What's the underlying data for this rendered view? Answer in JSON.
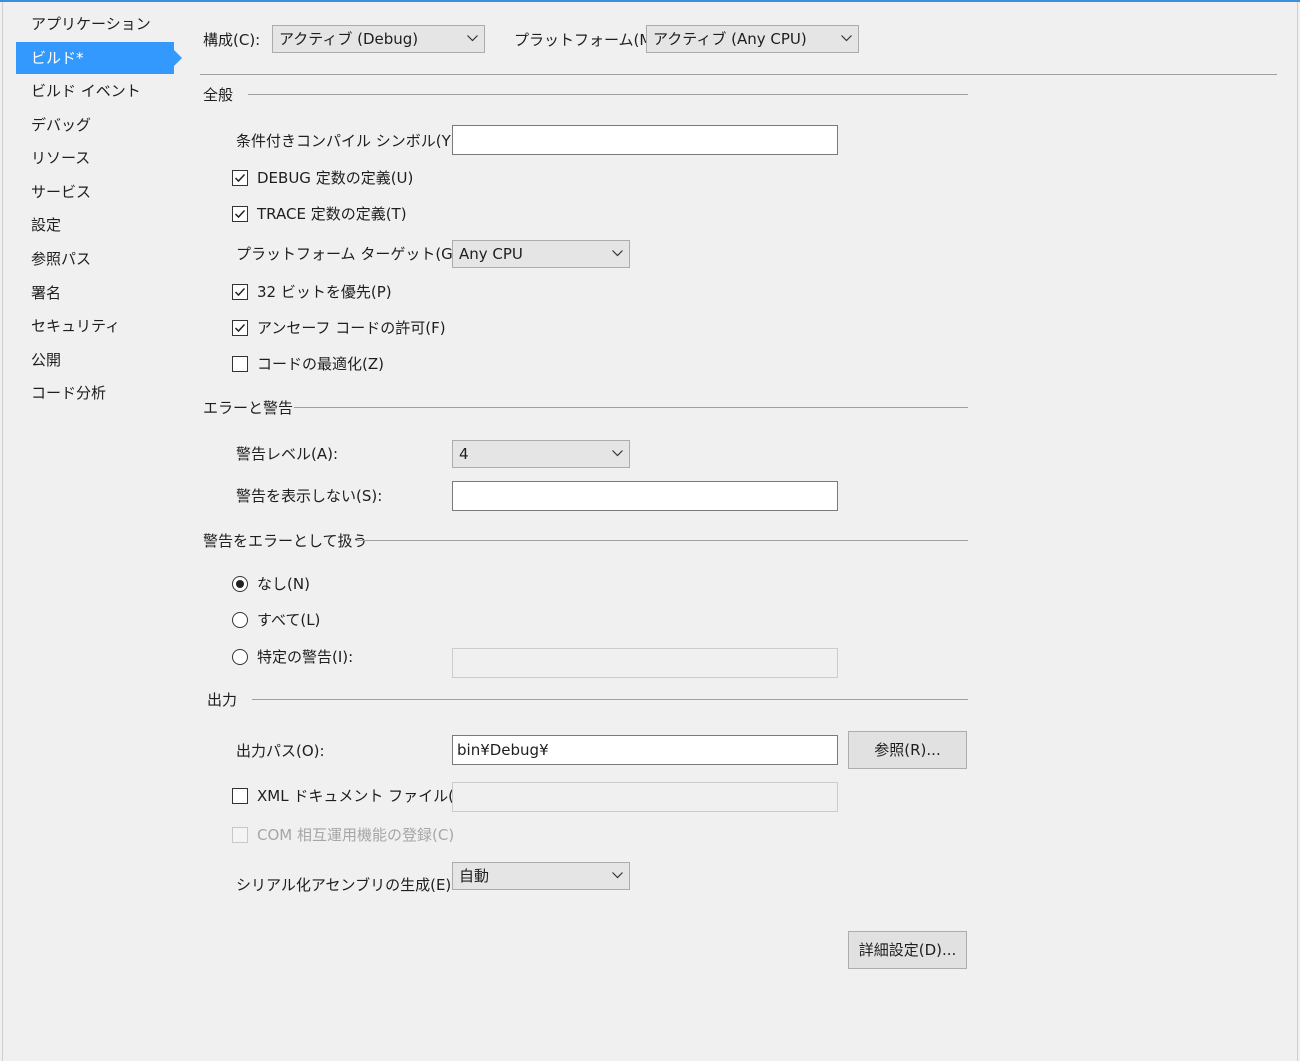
{
  "sidebar": {
    "items": [
      {
        "label": "アプリケーション"
      },
      {
        "label": "ビルド*"
      },
      {
        "label": "ビルド イベント"
      },
      {
        "label": "デバッグ"
      },
      {
        "label": "リソース"
      },
      {
        "label": "サービス"
      },
      {
        "label": "設定"
      },
      {
        "label": "参照パス"
      },
      {
        "label": "署名"
      },
      {
        "label": "セキュリティ"
      },
      {
        "label": "公開"
      },
      {
        "label": "コード分析"
      }
    ],
    "active_index": 1
  },
  "toolbar": {
    "config_label": "構成(C):",
    "config_value": "アクティブ (Debug)",
    "platform_label": "プラットフォーム(M):",
    "platform_value": "アクティブ (Any CPU)"
  },
  "general": {
    "title": "全般",
    "symbols_label": "条件付きコンパイル シンボル(Y):",
    "symbols_value": "",
    "debug_label": "DEBUG 定数の定義(U)",
    "debug_checked": true,
    "trace_label": "TRACE 定数の定義(T)",
    "trace_checked": true,
    "platform_target_label": "プラットフォーム ターゲット(G):",
    "platform_target_value": "Any CPU",
    "prefer32_label": "32 ビットを優先(P)",
    "prefer32_checked": true,
    "unsafe_label": "アンセーフ コードの許可(F)",
    "unsafe_checked": true,
    "optimize_label": "コードの最適化(Z)",
    "optimize_checked": false
  },
  "errors": {
    "title": "エラーと警告",
    "level_label": "警告レベル(A):",
    "level_value": "4",
    "suppress_label": "警告を表示しない(S):",
    "suppress_value": ""
  },
  "treat": {
    "title": "警告をエラーとして扱う",
    "none_label": "なし(N)",
    "all_label": "すべて(L)",
    "specific_label": "特定の警告(I):",
    "selected": "none",
    "specific_value": ""
  },
  "output": {
    "title": "出力",
    "path_label": "出力パス(O):",
    "path_value": "bin¥Debug¥",
    "browse_label": "参照(R)...",
    "xml_label": "XML ドキュメント ファイル(X):",
    "xml_checked": false,
    "xml_value": "",
    "com_label": "COM 相互運用機能の登録(C)",
    "com_checked": false,
    "com_enabled": false,
    "serial_label": "シリアル化アセンブリの生成(E):",
    "serial_value": "自動"
  },
  "advanced_label": "詳細設定(D)...",
  "colors": {
    "accent": "#3399ff",
    "top_border": "#3e8ede",
    "background": "#f0f0f0"
  }
}
